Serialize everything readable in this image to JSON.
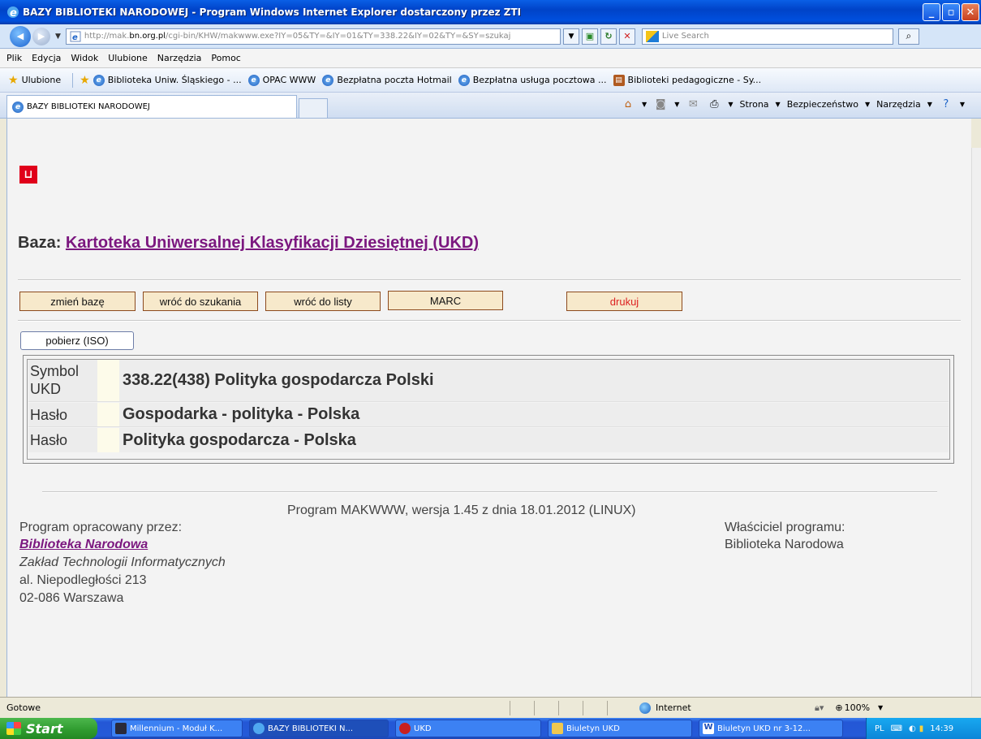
{
  "window": {
    "title": "BAZY BIBLIOTEKI NARODOWEJ - Program Windows Internet Explorer dostarczony przez ZTI"
  },
  "address": {
    "url_prefix": "http://mak.",
    "url_host": "bn.org.pl",
    "url_rest": "/cgi-bin/KHW/makwww.exe?IY=05&TY=&IY=01&TY=338.22&IY=02&TY=&SY=szukaj",
    "search_placeholder": "Live Search"
  },
  "menu": [
    "Plik",
    "Edycja",
    "Widok",
    "Ulubione",
    "Narzędzia",
    "Pomoc"
  ],
  "favorites": {
    "label": "Ulubione",
    "items": [
      "Biblioteka Uniw. Śląskiego - ...",
      "OPAC WWW",
      "Bezpłatna poczta Hotmail",
      "Bezpłatna usługa pocztowa ...",
      "Biblioteki pedagogiczne - Sy..."
    ]
  },
  "tab": {
    "label": "BAZY BIBLIOTEKI NARODOWEJ"
  },
  "command_bar": {
    "strona": "Strona",
    "bezpieczenstwo": "Bezpieczeństwo",
    "narzedzia": "Narzędzia"
  },
  "page": {
    "baza_label": "Baza:",
    "baza_link": "Kartoteka Uniwersalnej Klasyfikacji Dziesiętnej (UKD)",
    "buttons": {
      "zmien": "zmień bazę",
      "wroc_szukania": "wróć do szukania",
      "wroc_listy": "wróć do listy",
      "marc": "MARC",
      "drukuj": "drukuj",
      "pobierz": "pobierz (ISO)"
    },
    "record": [
      {
        "label": "Symbol UKD",
        "value": "338.22(438) Polityka gospodarcza Polski"
      },
      {
        "label": "Hasło",
        "value": "Gospodarka - polityka - Polska"
      },
      {
        "label": "Hasło",
        "value": "Polityka gospodarcza - Polska"
      }
    ],
    "footer": {
      "version": "Program MAKWWW, wersja 1.45 z dnia 18.01.2012 (LINUX)",
      "opracowany": "Program opracowany przez:",
      "bn_link": "Biblioteka Narodowa",
      "zaklad": "Zakład Technologii Informatycznych",
      "adres1": "al. Niepodległości 213",
      "adres2": "02-086 Warszawa",
      "wlasciciel": "Właściciel programu:",
      "wlasciciel_name": "Biblioteka Narodowa"
    }
  },
  "status": {
    "text": "Gotowe",
    "zone": "Internet",
    "zoom": "100%"
  },
  "taskbar": {
    "start": "Start",
    "tasks": [
      "Millennium - Moduł K...",
      "BAZY BIBLIOTEKI N...",
      "UKD",
      "Biuletyn UKD",
      "Biuletyn UKD nr 3-12..."
    ],
    "lang": "PL",
    "clock": "14:39"
  }
}
